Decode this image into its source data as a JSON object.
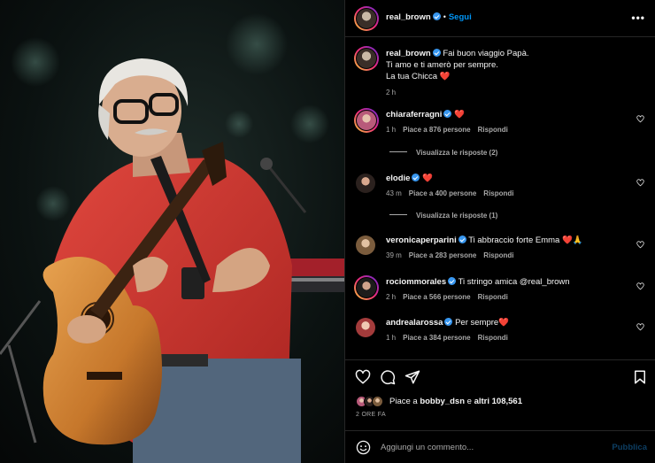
{
  "post": {
    "author": "real_brown",
    "follow_label": "Segui",
    "dot": "•",
    "more_label": "•••"
  },
  "caption": {
    "author": "real_brown",
    "line1": "Fai buon viaggio Papà.",
    "line2": "Ti amo e ti amerò per sempre.",
    "line3": "La tua Chicca ❤️",
    "time": "2 h"
  },
  "comments": [
    {
      "user": "chiaraferragni",
      "text": "❤️",
      "time": "1 h",
      "likes": "Piace a 876 persone",
      "reply": "Rispondi",
      "view_replies": "Visualizza le risposte (2)"
    },
    {
      "user": "elodie",
      "text": "❤️",
      "time": "43 m",
      "likes": "Piace a 400 persone",
      "reply": "Rispondi",
      "view_replies": "Visualizza le risposte (1)"
    },
    {
      "user": "veronicaperparini",
      "text": "Ti abbraccio forte Emma ❤️🙏",
      "time": "39 m",
      "likes": "Piace a 283 persone",
      "reply": "Rispondi"
    },
    {
      "user": "rociommorales",
      "text": "Ti stringo amica @real_brown",
      "time": "2 h",
      "likes": "Piace a 566 persone",
      "reply": "Rispondi"
    },
    {
      "user": "andrealarossa",
      "text": "Per sempre❤️",
      "time": "1 h",
      "likes": "Piace a 384 persone",
      "reply": "Rispondi"
    }
  ],
  "likes": {
    "prefix": "Piace a",
    "user": "bobby_dsn",
    "connector": "e",
    "others": "altri 108,561"
  },
  "time_ago": "2 ORE FA",
  "add_comment": {
    "placeholder": "Aggiungi un commento...",
    "post_label": "Pubblica"
  },
  "icons": {
    "more": "more-options-icon",
    "verified": "verified-badge-icon",
    "like": "heart-icon",
    "comment": "comment-icon",
    "share": "send-icon",
    "save": "bookmark-icon",
    "emoji": "emoji-icon"
  },
  "colors": {
    "accent": "#0095f6",
    "verified": "#3897f0",
    "muted": "#a8a8a8",
    "shirt": "#c9302c"
  }
}
